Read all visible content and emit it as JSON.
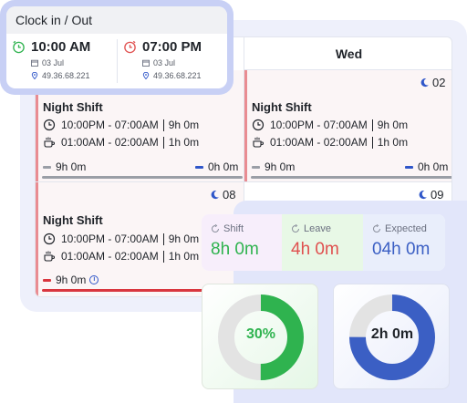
{
  "calendar": {
    "column_header": "Wed",
    "cells": [
      {
        "day": "02",
        "title": "Night Shift",
        "shift_time": "10:00PM - 07:00AM",
        "shift_hours": "9h 0m",
        "break_time": "01:00AM - 02:00AM",
        "break_hours": "1h 0m",
        "worked": "9h 0m",
        "remaining": "0h 0m"
      },
      {
        "day": "08",
        "title": "Night Shift",
        "shift_time": "10:00PM - 07:00AM",
        "shift_hours": "9h 0m",
        "break_time": "01:00AM - 02:00AM",
        "break_hours": "1h 0m",
        "worked": "9h 0m"
      },
      {
        "day": "09"
      }
    ],
    "left_top_cell": {
      "title": "Night Shift",
      "shift_time": "10:00PM - 07:00AM",
      "shift_hours": "9h 0m",
      "break_time": "01:00AM - 02:00AM",
      "break_hours": "1h 0m",
      "worked": "9h 0m",
      "remaining": "0h 0m"
    }
  },
  "clock": {
    "title": "Clock in / Out",
    "in": {
      "time": "10:00 AM",
      "date": "03 Jul",
      "ip": "49.36.68.221"
    },
    "out": {
      "time": "07:00 PM",
      "date": "03 Jul",
      "ip": "49.36.68.221"
    }
  },
  "stats": {
    "shift": {
      "label": "Shift",
      "value": "8h 0m"
    },
    "leave": {
      "label": "Leave",
      "value": "4h 0m"
    },
    "expected": {
      "label": "Expected",
      "value": "04h 0m"
    }
  },
  "donuts": {
    "percent": {
      "label": "30%",
      "fraction": 0.5
    },
    "hours": {
      "label": "2h 0m",
      "fraction": 0.75
    }
  },
  "colors": {
    "green": "#2fb34f",
    "red": "#e0504f",
    "blue": "#3b5fc4",
    "donut_track": "#e3e3e3"
  }
}
